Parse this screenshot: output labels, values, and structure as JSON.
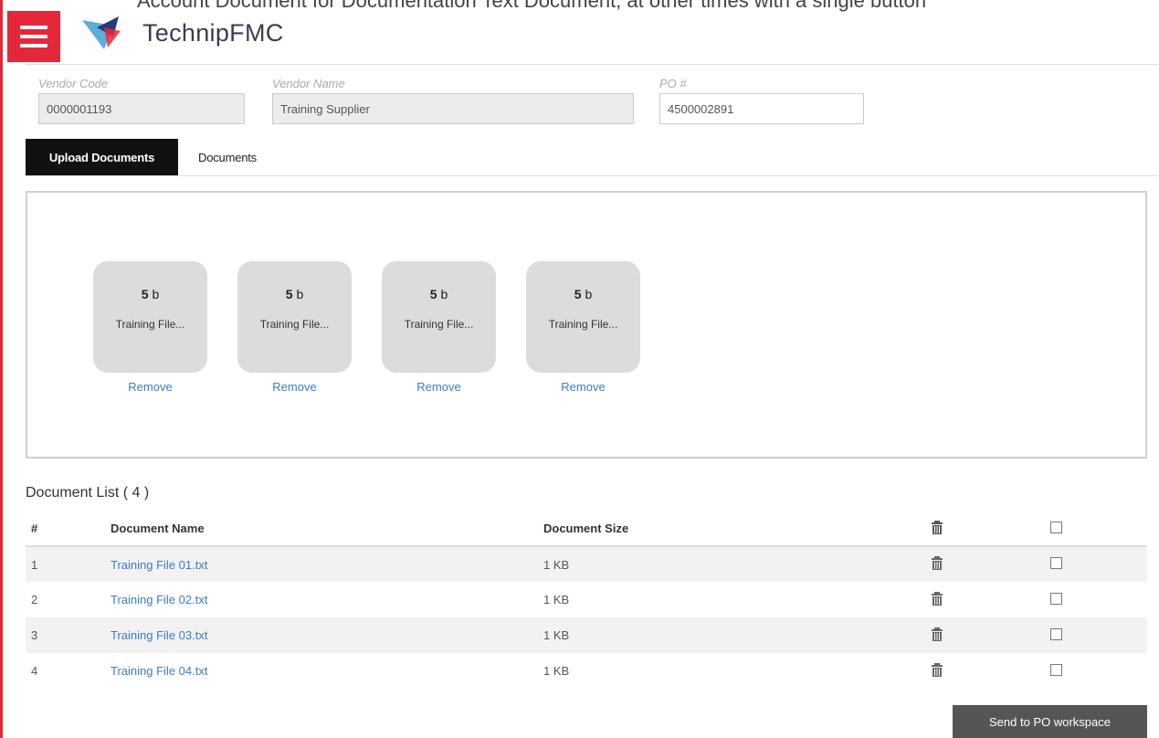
{
  "top_text": "Account Document for Documentation Text Document, at other times with a single button",
  "header": {
    "logo_text": "TechnipFMC"
  },
  "fields": {
    "vendor_code": {
      "label": "Vendor Code",
      "value": "0000001193"
    },
    "vendor_name": {
      "label": "Vendor Name",
      "value": "Training Supplier"
    },
    "po": {
      "label": "PO #",
      "value": "4500002891"
    }
  },
  "tabs": [
    {
      "label": "Upload Documents"
    },
    {
      "label": "Documents"
    }
  ],
  "uploads": [
    {
      "size_num": "5",
      "size_unit": "b",
      "name": "Training File...",
      "remove": "Remove"
    },
    {
      "size_num": "5",
      "size_unit": "b",
      "name": "Training File...",
      "remove": "Remove"
    },
    {
      "size_num": "5",
      "size_unit": "b",
      "name": "Training File...",
      "remove": "Remove"
    },
    {
      "size_num": "5",
      "size_unit": "b",
      "name": "Training File...",
      "remove": "Remove"
    }
  ],
  "doc_list": {
    "title": "Document List ( 4 )",
    "headers": {
      "num": "#",
      "name": "Document Name",
      "size": "Document Size"
    },
    "rows": [
      {
        "num": "1",
        "name": "Training File 01.txt",
        "size": "1 KB"
      },
      {
        "num": "2",
        "name": "Training File 02.txt",
        "size": "1 KB"
      },
      {
        "num": "3",
        "name": "Training File 03.txt",
        "size": "1 KB"
      },
      {
        "num": "4",
        "name": "Training File 04.txt",
        "size": "1 KB"
      }
    ]
  },
  "actions": {
    "send_label": "Send to PO workspace"
  },
  "colors": {
    "brand_red": "#e4283a",
    "link_blue": "#3a7cc8"
  }
}
